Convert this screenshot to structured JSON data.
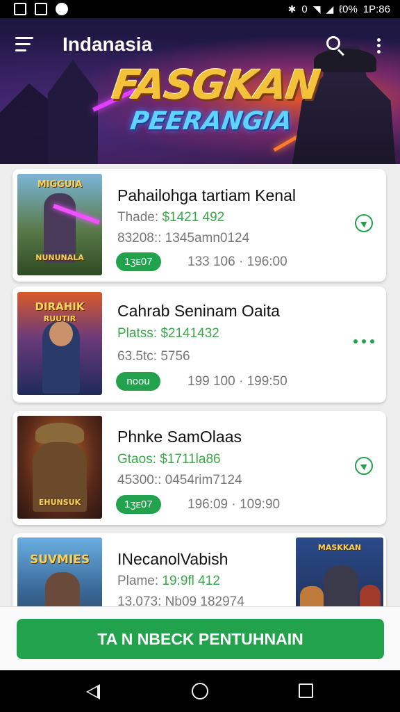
{
  "status_bar": {
    "bluetooth_icon": "bluetooth-icon",
    "vibrate_glyph": "0",
    "battery_text": "ℓ0%",
    "time": "1P:86"
  },
  "header": {
    "title": "Indanasia",
    "banner_title": "FASGKAN",
    "banner_subtitle": "PEERANGIA"
  },
  "cards": [
    {
      "title": "Pahailohga tartiam Kenal",
      "price_label": "Thade: ",
      "price_value": "$1421 492",
      "meta": "83208:: 1345amn0124",
      "badge": "1ʒᴇ07",
      "date": "133 106 · 196:00",
      "thumb_text": "MIGGUIA",
      "thumb_text2": "NUNUNALA",
      "action_icon": "play-icon"
    },
    {
      "title": "Cahrab Seninam Oaita",
      "price_label": "Platss: ",
      "price_value": "$2141432",
      "meta": "63.5tc: 5756",
      "badge": "noou",
      "date": "199 100 · 199:50",
      "thumb_text": "DIRAHIK",
      "thumb_text2": "RUUTIR",
      "action_icon": "more-icon"
    },
    {
      "title": "Phnke SamOlaas",
      "price_label": "Gtaos: ",
      "price_value": "$1711la86",
      "meta": "45300:: 0454rim7124",
      "badge": "1ʒᴇ07",
      "date": "196:09 · 109:90",
      "thumb_text": "EHUNSUK",
      "thumb_text2": "",
      "action_icon": "play-icon"
    },
    {
      "title": "INecanolVabish",
      "price_label": "Plame: ",
      "price_value": "19:9fl 412",
      "meta": "13.073: Nb09 182974",
      "thumb_text": "SUVMIES",
      "thumb_text2": "",
      "thumb2_text": "MASKKAN"
    }
  ],
  "cta": {
    "label": "TA N NBECK PENTUHNAIN"
  },
  "colors": {
    "accent_green": "#23a24d",
    "price_green": "#3aa84a"
  }
}
